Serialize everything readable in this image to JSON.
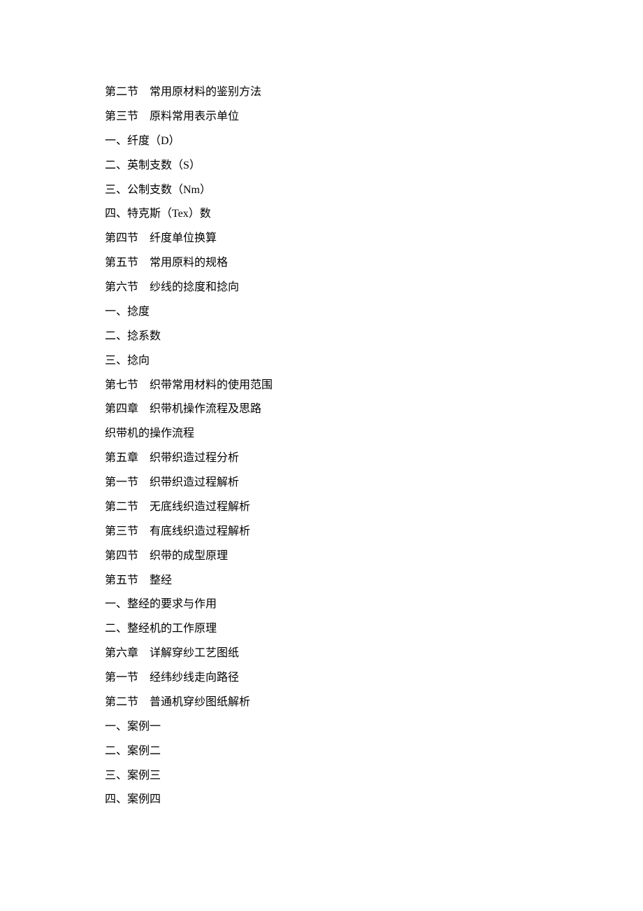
{
  "toc": {
    "lines": [
      "第二节　常用原材料的鉴别方法",
      "第三节　原料常用表示单位",
      "一、纤度（D）",
      "二、英制支数（S）",
      "三、公制支数（Nm）",
      "四、特克斯（Tex）数",
      "第四节　纤度单位换算",
      "第五节　常用原料的规格",
      "第六节　纱线的捻度和捻向",
      "一、捻度",
      "二、捻系数",
      "三、捻向",
      "第七节　织带常用材料的使用范围",
      "第四章　织带机操作流程及思路",
      "织带机的操作流程",
      "第五章　织带织造过程分析",
      "第一节　织带织造过程解析",
      "第二节　无底线织造过程解析",
      "第三节　有底线织造过程解析",
      "第四节　织带的成型原理",
      "第五节　整经",
      "一、整经的要求与作用",
      "二、整经机的工作原理",
      "第六章　详解穿纱工艺图纸",
      "第一节　经纬纱线走向路径",
      "第二节　普通机穿纱图纸解析",
      "一、案例一",
      "二、案例二",
      "三、案例三",
      "四、案例四"
    ]
  }
}
